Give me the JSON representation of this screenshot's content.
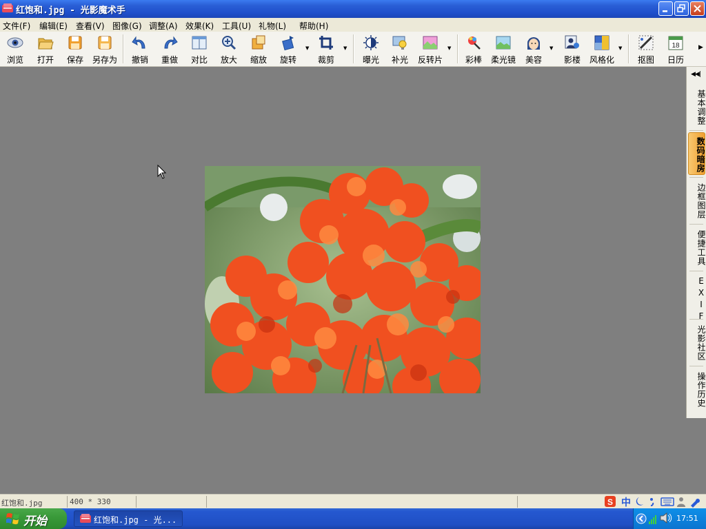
{
  "window": {
    "title": "红饱和.jpg - 光影魔术手"
  },
  "menu": {
    "items": [
      "文件(F)",
      "编辑(E)",
      "查看(V)",
      "图像(G)",
      "调整(A)",
      "效果(K)",
      "工具(U)",
      "礼物(L)",
      "帮助(H)"
    ]
  },
  "toolbar": {
    "buttons": [
      "浏览",
      "打开",
      "保存",
      "另存为",
      "撤销",
      "重做",
      "对比",
      "放大",
      "缩放",
      "旋转",
      "裁剪",
      "曝光",
      "补光",
      "反转片",
      "彩棒",
      "柔光镜",
      "美容",
      "影楼",
      "风格化",
      "抠图",
      "日历"
    ],
    "calendar_day": "18"
  },
  "right_panel": {
    "tabs": [
      "基本调整",
      "数码暗房",
      "边框图层",
      "便捷工具",
      "EXIF",
      "光影社区",
      "操作历史"
    ],
    "active": "数码暗房"
  },
  "status": {
    "filename": "红饱和.jpg",
    "dimensions": "400 * 330"
  },
  "taskbar": {
    "start_label": "开始",
    "task_label": "红饱和.jpg - 光...",
    "clock": "17:51"
  },
  "colors": {
    "title_blue": "#2a5fd6",
    "canvas_gray": "#7f7f7f",
    "start_green": "#3a9a3a",
    "active_tab_orange": "#f0a030"
  }
}
